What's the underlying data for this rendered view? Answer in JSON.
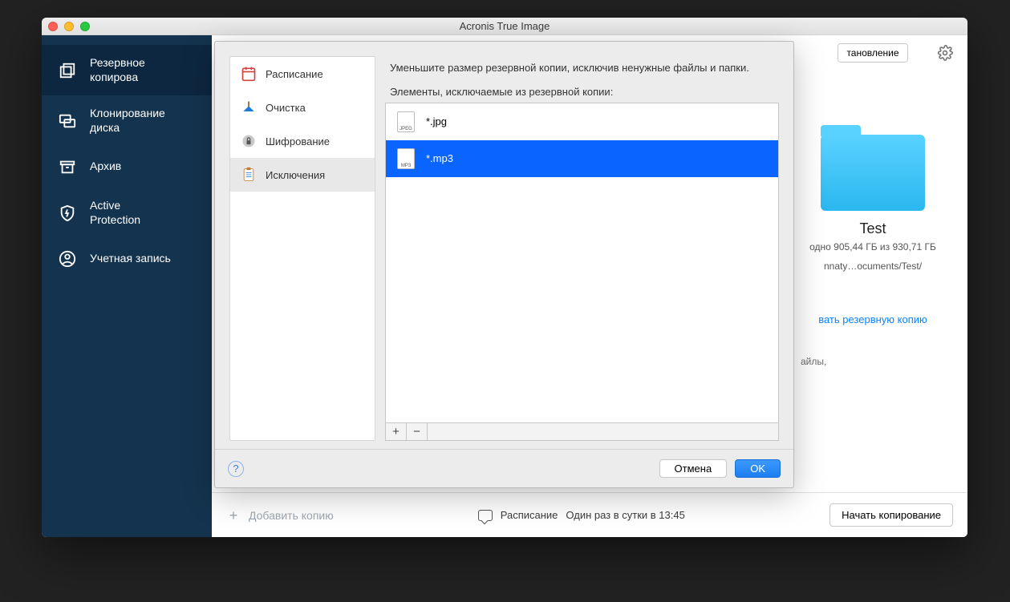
{
  "window": {
    "title": "Acronis True Image"
  },
  "sidebar": {
    "items": [
      {
        "label": "Резервное копирова"
      },
      {
        "label": "Клонирование диска"
      },
      {
        "label": "Архив"
      },
      {
        "label": "Active\nProtection"
      },
      {
        "label": "Учетная запись"
      }
    ]
  },
  "header": {
    "segment": "тановление"
  },
  "destination": {
    "name": "Test",
    "free": "одно 905,44 ГБ из 930,71 ГБ",
    "path": "nnaty…ocuments/Test/",
    "action_link": "вать резервную копию",
    "files_text": "айлы,"
  },
  "footer": {
    "add_backup": "Добавить копию",
    "schedule_label": "Расписание",
    "schedule_value": "Один раз в сутки в 13:45",
    "start": "Начать копирование"
  },
  "modal": {
    "tabs": [
      {
        "label": "Расписание"
      },
      {
        "label": "Очистка"
      },
      {
        "label": "Шифрование"
      },
      {
        "label": "Исключения"
      }
    ],
    "description": "Уменьшите размер резервной копии, исключив ненужные файлы и папки.",
    "list_label": "Элементы, исключаемые из резервной копии:",
    "exclusions": [
      {
        "type": "JPEG",
        "pattern": "*.jpg",
        "selected": false
      },
      {
        "type": "MP3",
        "pattern": "*.mp3",
        "selected": true
      }
    ],
    "buttons": {
      "add": "+",
      "remove": "−",
      "cancel": "Отмена",
      "ok": "OK",
      "help": "?"
    }
  }
}
